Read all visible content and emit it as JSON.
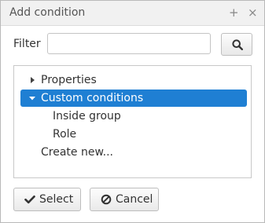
{
  "dialog": {
    "title": "Add condition",
    "plus_label": "+",
    "close_label": "×"
  },
  "filter": {
    "label": "Filter",
    "value": "",
    "placeholder": "",
    "search_icon": "search-icon"
  },
  "tree": {
    "nodes": [
      {
        "label": "Properties",
        "expanded": false,
        "selected": false,
        "depth": 0
      },
      {
        "label": "Custom conditions",
        "expanded": true,
        "selected": true,
        "depth": 0
      },
      {
        "label": "Inside group",
        "selected": false,
        "depth": 1
      },
      {
        "label": "Role",
        "selected": false,
        "depth": 1
      },
      {
        "label": "Create new...",
        "selected": false,
        "depth": 0
      }
    ]
  },
  "buttons": {
    "select_label": "Select",
    "cancel_label": "Cancel"
  },
  "colors": {
    "selection": "#1f7fd3",
    "titlebar": "#f1f1f1"
  }
}
